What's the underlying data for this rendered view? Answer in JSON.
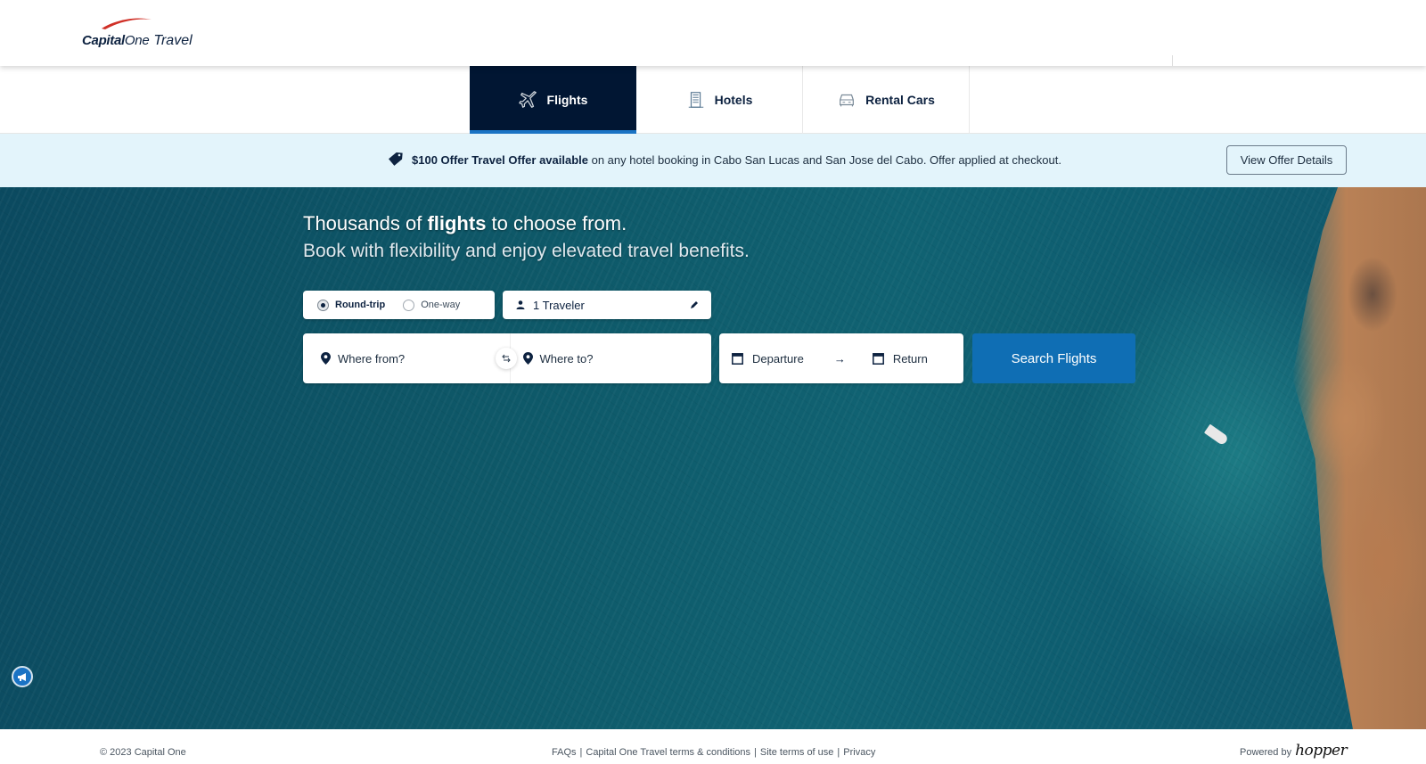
{
  "header": {
    "logo_brand_bold": "Capital",
    "logo_brand_one": "One",
    "logo_product": "Travel",
    "brand_colors": {
      "navy": "#0d2240",
      "red": "#d03027"
    }
  },
  "tabs": [
    {
      "label": "Flights",
      "icon": "airplane-icon",
      "active": true
    },
    {
      "label": "Hotels",
      "icon": "hotel-icon",
      "active": false
    },
    {
      "label": "Rental Cars",
      "icon": "car-icon",
      "active": false
    }
  ],
  "offer": {
    "icon": "tag-icon",
    "headline": "$100 Offer Travel Offer available",
    "detail": " on any hotel booking in Cabo San Lucas and San Jose del Cabo. Offer applied at checkout.",
    "button_label": "View Offer Details"
  },
  "hero": {
    "title_pre": "Thousands of ",
    "title_bold": "flights",
    "title_post": " to choose from.",
    "subtitle": "Book with flexibility and enjoy elevated travel benefits."
  },
  "search": {
    "trip_types": [
      {
        "label": "Round-trip",
        "selected": true
      },
      {
        "label": "One-way",
        "selected": false
      }
    ],
    "travelers": "1 Traveler",
    "origin_placeholder": "Where from?",
    "destination_placeholder": "Where to?",
    "departure_placeholder": "Departure",
    "return_placeholder": "Return",
    "submit_label": "Search Flights",
    "accent": "#0f6eb4"
  },
  "footer": {
    "copyright": "© 2023 Capital One",
    "links": [
      "FAQs",
      "Capital One Travel terms & conditions",
      "Site terms of use",
      "Privacy"
    ],
    "separator": "|",
    "powered_by": "Powered by",
    "partner": "hopper"
  }
}
